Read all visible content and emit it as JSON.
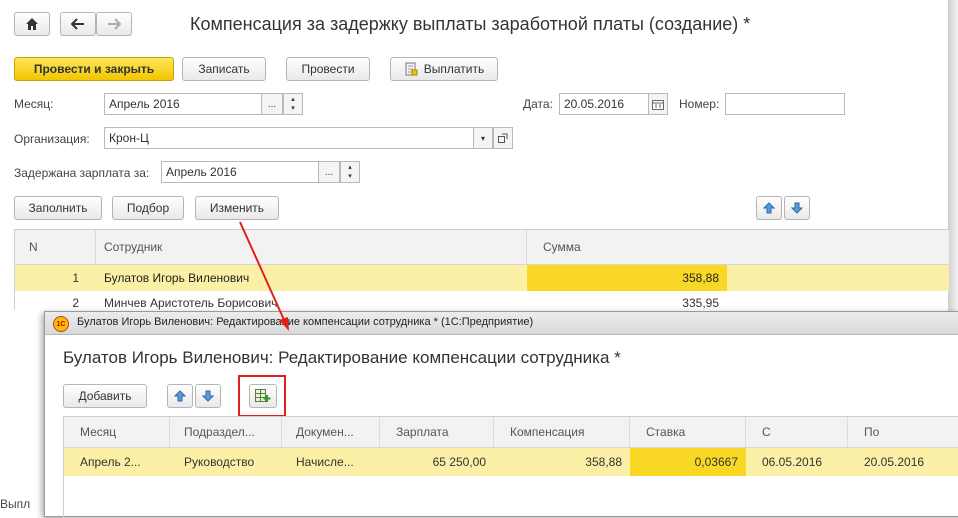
{
  "main": {
    "title": "Компенсация за задержку выплаты заработной платы (создание) *",
    "nav": {
      "home_icon": "home-icon",
      "back_icon": "arrow-left-icon",
      "forward_icon": "arrow-right-icon"
    },
    "toolbar": {
      "post_close": "Провести и закрыть",
      "save": "Записать",
      "post": "Провести",
      "pay": "Выплатить"
    },
    "month_label": "Месяц:",
    "month_value": "Апрель 2016",
    "date_label": "Дата:",
    "date_value": "20.05.2016",
    "number_label": "Номер:",
    "number_value": "",
    "org_label": "Организация:",
    "org_value": "Крон-Ц",
    "delayed_label": "Задержана зарплата за:",
    "delayed_value": "Апрель 2016",
    "table_buttons": {
      "fill": "Заполнить",
      "select": "Подбор",
      "edit": "Изменить"
    },
    "table": {
      "headers": {
        "n": "N",
        "employee": "Сотрудник",
        "amount": "Сумма"
      },
      "rows": [
        {
          "n": "1",
          "employee": "Булатов Игорь Виленович",
          "amount": "358,88"
        },
        {
          "n": "2",
          "employee": "Минчев Аристотель Борисович",
          "amount": "335,95"
        }
      ]
    },
    "bottom_text": "Выпл"
  },
  "dialog": {
    "window_title": "Булатов Игорь Виленович: Редактирование компенсации сотрудника * (1С:Предприятие)",
    "heading": "Булатов Игорь Виленович: Редактирование компенсации сотрудника *",
    "add_button": "Добавить",
    "table": {
      "headers": {
        "month": "Месяц",
        "dept": "Подраздел...",
        "doc": "Докумен...",
        "salary": "Зарплата",
        "comp": "Компенсация",
        "rate": "Ставка",
        "from": "С",
        "to": "По"
      },
      "rows": [
        {
          "month": "Апрель 2...",
          "dept": "Руководство",
          "doc": "Начисле...",
          "salary": "65 250,00",
          "comp": "358,88",
          "rate": "0,03667",
          "from": "06.05.2016",
          "to": "20.05.2016"
        }
      ]
    }
  },
  "colors": {
    "accent": "#f2c600",
    "row_highlight": "#fbf0a6",
    "cell_highlight": "#f9d825",
    "annotation": "#e0201c"
  }
}
